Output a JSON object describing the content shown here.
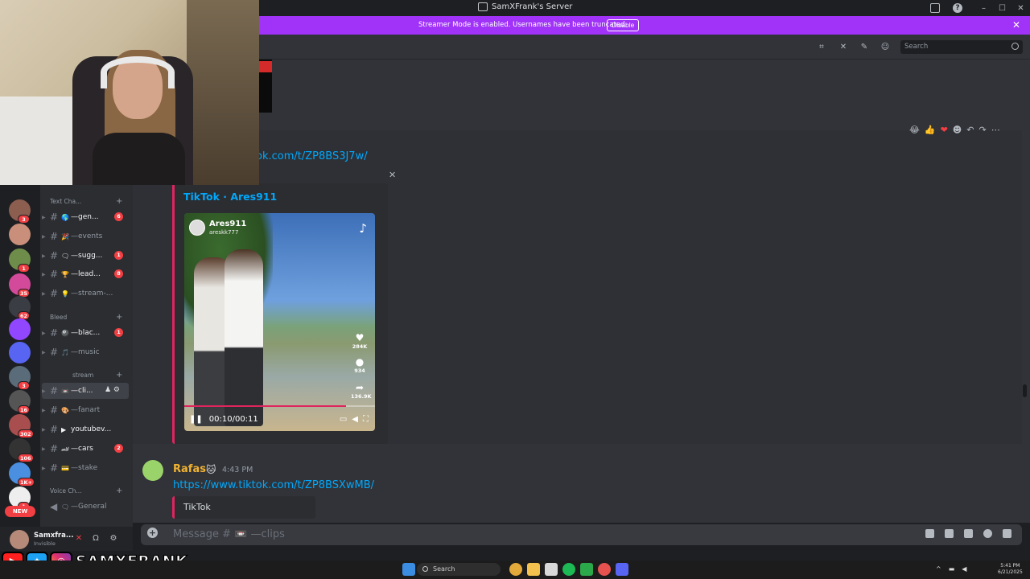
{
  "window": {
    "title": "SamXFrank's Server",
    "controls": [
      "–",
      "☐",
      "✕"
    ]
  },
  "banner": {
    "text": "Streamer Mode is enabled. Usernames have been truncated.",
    "button": "Disable",
    "close": "✕",
    "color": "#a033f7"
  },
  "header": {
    "search_placeholder": "Search"
  },
  "reactions": [
    "😂",
    "👍",
    "❤",
    "☻",
    "↶",
    "↷",
    "⋯"
  ],
  "message1": {
    "link": "ok.com/t/ZP8BS3J7w/",
    "embed": {
      "close": "✕",
      "title": "TikTok · Ares911",
      "video": {
        "author": "Ares911",
        "handle": "areskk777",
        "likes": "284K",
        "comments": "934",
        "shares": "136.9K",
        "time": "00:10/00:11",
        "watermark": "TikTok",
        "progress": 0.85
      }
    }
  },
  "message2": {
    "author": "Rafas",
    "badge": "🐱",
    "time": "4:43 PM",
    "link": "https://www.tiktok.com/t/ZP8BSXwMB/",
    "embed_title": "TikTok"
  },
  "composer": {
    "placeholder": "Message # 📼 —clips"
  },
  "servers": [
    {
      "badge": "3"
    },
    {
      "badge": ""
    },
    {
      "badge": "1"
    },
    {
      "badge": "35"
    },
    {
      "badge": "62"
    },
    {
      "badge": ""
    },
    {
      "badge": ""
    },
    {
      "badge": "3"
    },
    {
      "badge": "16"
    },
    {
      "badge": "302"
    },
    {
      "badge": "106"
    },
    {
      "badge": "1K+"
    },
    {
      "badge": "1"
    }
  ],
  "new_pill": "NEW",
  "categories": {
    "text": "Text Cha...",
    "bleed": "Bleed",
    "stream": "stream",
    "voice": "Voice Ch..."
  },
  "channels": [
    {
      "emoji": "🌎",
      "label": "—gen...",
      "badge": "6"
    },
    {
      "emoji": "🎉",
      "label": "—events",
      "badge": ""
    },
    {
      "emoji": "🗨",
      "label": "—sugg...",
      "badge": "1"
    },
    {
      "emoji": "🏆",
      "label": "—lead...",
      "badge": "8"
    },
    {
      "emoji": "💡",
      "label": "—stream-...",
      "badge": ""
    },
    {
      "emoji": "🎱",
      "label": "—blac...",
      "badge": "1"
    },
    {
      "emoji": "🎵",
      "label": "—music",
      "badge": ""
    },
    {
      "emoji": "📼",
      "label": "—cli...",
      "badge": ""
    },
    {
      "emoji": "🎨",
      "label": "—fanart",
      "badge": ""
    },
    {
      "emoji": "▶",
      "label": "youtubev...",
      "badge": ""
    },
    {
      "emoji": "🏎",
      "label": "—cars",
      "badge": "2"
    },
    {
      "emoji": "💳",
      "label": "—stake",
      "badge": ""
    }
  ],
  "voice_channel": {
    "label": "—General"
  },
  "user": {
    "name": "Samxfra...",
    "status": "Invisible"
  },
  "social": {
    "handle": "SAMXFRANK"
  },
  "taskbar": {
    "search": "Search",
    "time": "5:41 PM",
    "date": "6/21/2025"
  }
}
